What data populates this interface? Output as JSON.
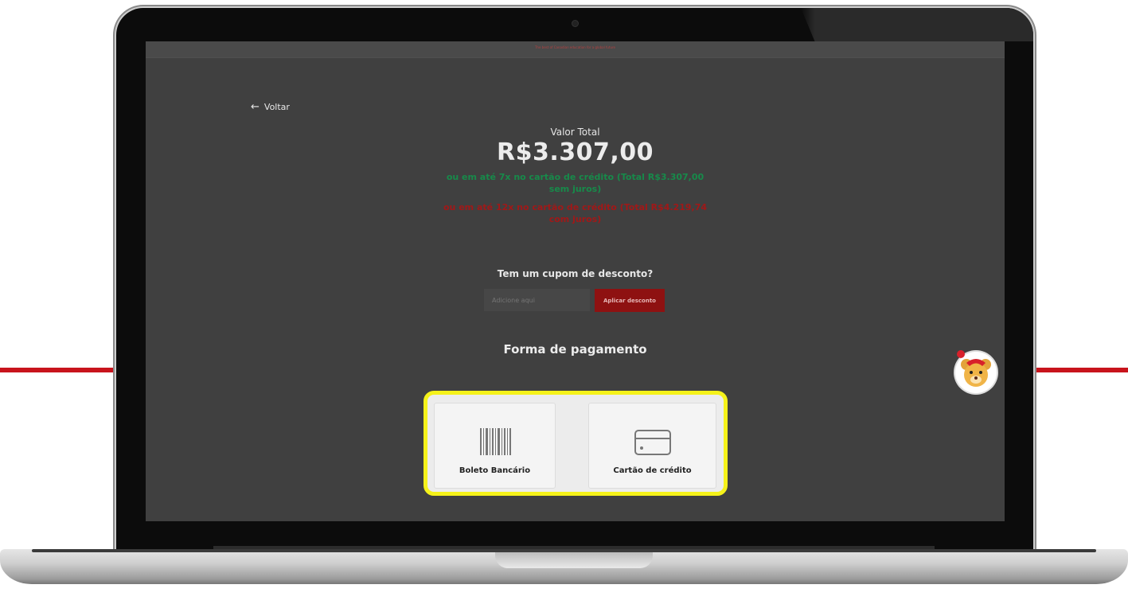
{
  "page": {
    "tagline": "The best of Canadian education for a global future",
    "back_label": "Voltar",
    "total_label": "Valor Total",
    "total_value": "R$3.307,00",
    "installments_interest_free_line1": "ou em até 7x no cartão de crédito (Total R$3.307,00",
    "installments_interest_free_line2": "sem juros)",
    "installments_with_interest_line1": "ou em até 12x no cartão de crédito (Total R$4.219,74",
    "installments_with_interest_line2": "com juros)"
  },
  "coupon": {
    "title": "Tem um cupom de desconto?",
    "placeholder": "Adicione aqui",
    "button_label": "Aplicar desconto"
  },
  "payment": {
    "title": "Forma de pagamento",
    "options": [
      {
        "label": "Boleto Bancário",
        "icon": "barcode-icon"
      },
      {
        "label": "Cartão de crédito",
        "icon": "credit-card-icon"
      }
    ]
  },
  "colors": {
    "accent_red": "#c8141c",
    "highlight_yellow": "#f5f21a",
    "interest_free_green": "#178a4a",
    "with_interest_red": "#a01818"
  }
}
